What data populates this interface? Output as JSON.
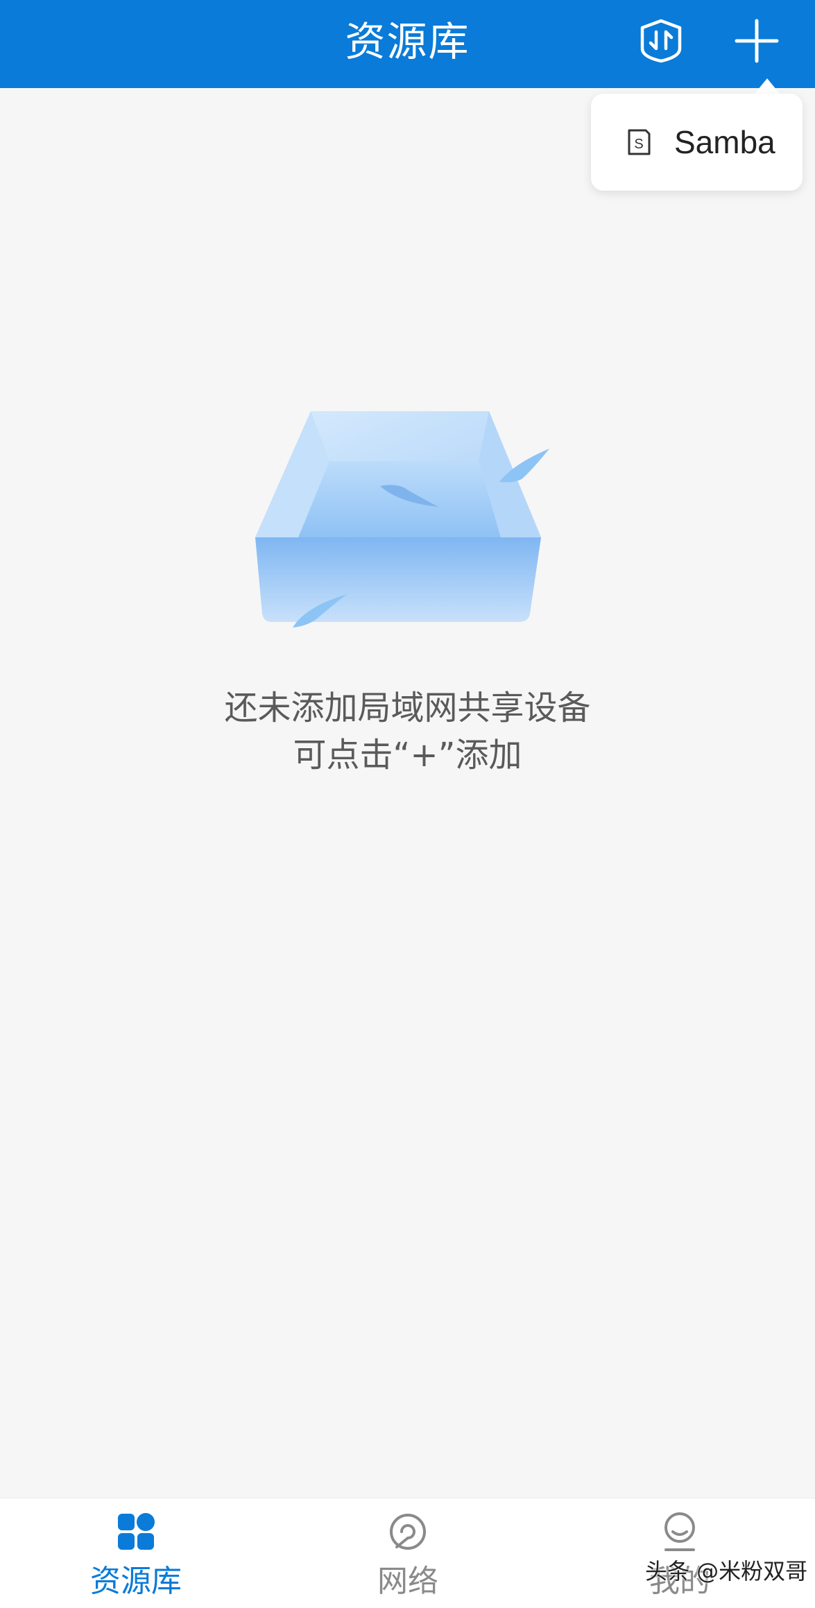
{
  "header": {
    "title": "资源库",
    "sync_icon": "sync-transfer-icon",
    "add_icon": "plus-icon"
  },
  "add_menu": {
    "items": [
      {
        "label": "Samba",
        "icon": "samba-s-icon"
      }
    ]
  },
  "empty_state": {
    "illustration": "empty-box-illustration",
    "line1": "还未添加局域网共享设备",
    "line2": "可点击“+”添加"
  },
  "tabbar": {
    "tabs": [
      {
        "label": "资源库",
        "icon": "grid-icon",
        "active": true
      },
      {
        "label": "网络",
        "icon": "network-icon",
        "active": false
      },
      {
        "label": "我的",
        "icon": "profile-icon",
        "active": false
      }
    ]
  },
  "watermark": "头条 @米粉双哥",
  "colors": {
    "accent": "#0a7bd8",
    "background": "#f6f6f6",
    "text_secondary": "#5a5a5a",
    "tab_inactive": "#8a8a8a"
  }
}
